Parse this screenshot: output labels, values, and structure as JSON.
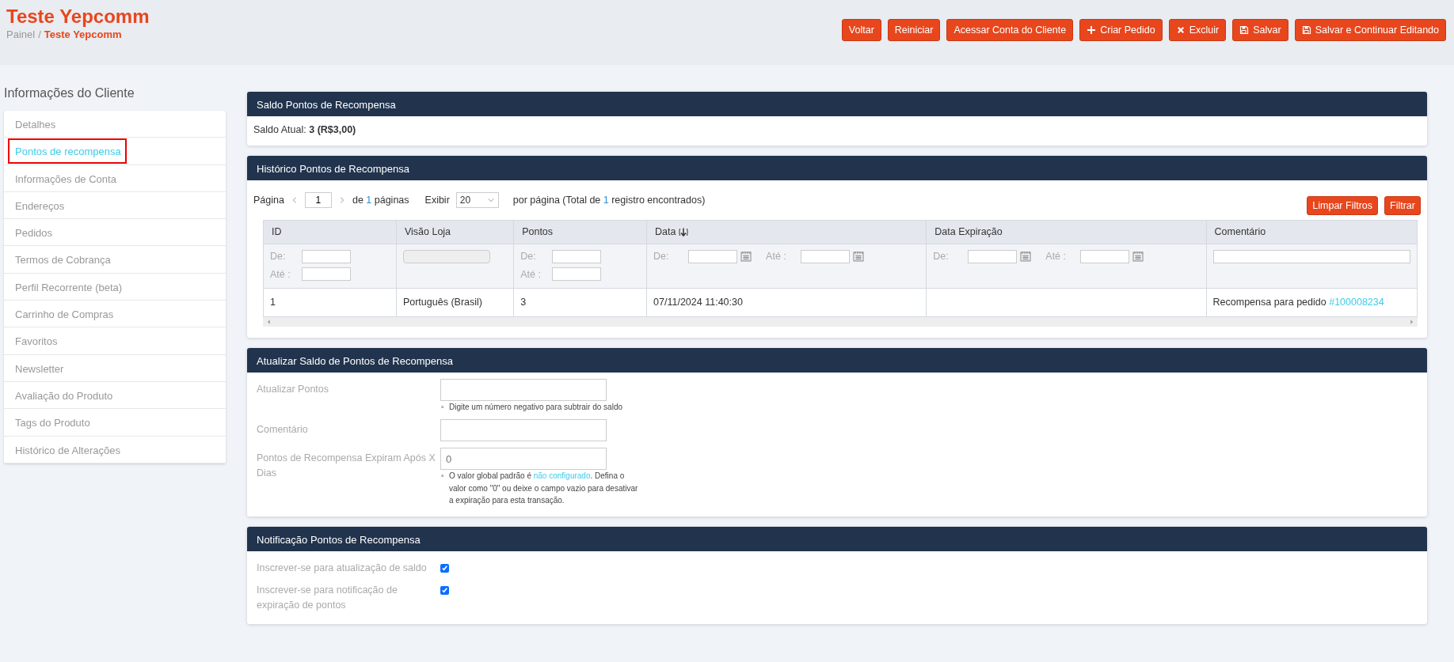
{
  "header": {
    "title": "Teste Yepcomm",
    "breadcrumb": [
      {
        "label": "Painel",
        "current": false
      },
      {
        "label": "Teste Yepcomm",
        "current": true
      }
    ],
    "separator": "/",
    "buttons": [
      {
        "label": "Voltar",
        "kind": "plain"
      },
      {
        "label": "Reiniciar",
        "kind": "plain"
      },
      {
        "label": "Acessar Conta do Cliente",
        "kind": "plain"
      },
      {
        "label": "Criar Pedido",
        "kind": "add"
      },
      {
        "label": "Excluir",
        "kind": "delete"
      },
      {
        "label": "Salvar",
        "kind": "save"
      },
      {
        "label": "Salvar e Continuar Editando",
        "kind": "save"
      }
    ]
  },
  "sidebar": {
    "title": "Informações do Cliente",
    "items": [
      {
        "label": "Detalhes",
        "selected": false
      },
      {
        "label": "Pontos de recompensa",
        "selected": true
      },
      {
        "label": "Informações de Conta",
        "selected": false
      },
      {
        "label": "Endereços",
        "selected": false
      },
      {
        "label": "Pedidos",
        "selected": false
      },
      {
        "label": "Termos de Cobrança",
        "selected": false
      },
      {
        "label": "Perfil Recorrente (beta)",
        "selected": false
      },
      {
        "label": "Carrinho de Compras",
        "selected": false
      },
      {
        "label": "Favoritos",
        "selected": false
      },
      {
        "label": "Newsletter",
        "selected": false
      },
      {
        "label": "Avaliação do Produto",
        "selected": false
      },
      {
        "label": "Tags do Produto",
        "selected": false
      },
      {
        "label": "Histórico de Alterações",
        "selected": false
      }
    ]
  },
  "balance": {
    "title": "Saldo Pontos de Recompensa",
    "label": "Saldo Atual:",
    "value": "3 (R$3,00)"
  },
  "history": {
    "title": "Histórico Pontos de Recompensa",
    "pager": {
      "page_label": "Página",
      "page": "1",
      "of_text": "de",
      "total_pages": "1",
      "pages_word": "páginas",
      "show_label": "Exibir",
      "per_page": "20",
      "per_page_text": "por página (Total de",
      "total": "1",
      "total_text": "registro encontrados)"
    },
    "buttons": [
      "Limpar Filtros",
      "Filtrar"
    ],
    "table": {
      "columns": [
        {
          "label": "ID",
          "sorted": false,
          "filter": {
            "kind": "range",
            "from": "De:",
            "to": "Até :"
          }
        },
        {
          "label": "Visão Loja",
          "sorted": false,
          "filter": {
            "kind": "select"
          }
        },
        {
          "label": "Pontos",
          "sorted": false,
          "filter": {
            "kind": "range",
            "from": "De:",
            "to": "Até :"
          }
        },
        {
          "label": "Data",
          "sorted": true,
          "filter": {
            "kind": "date_range",
            "from": "De:",
            "to": "Até :"
          }
        },
        {
          "label": "Data Expiração",
          "sorted": false,
          "filter": {
            "kind": "date_range",
            "from": "De:",
            "to": "Até :"
          }
        },
        {
          "label": "Comentário",
          "sorted": false,
          "filter": {
            "kind": "text"
          }
        }
      ],
      "rows": [
        {
          "cells": [
            {
              "text": "1"
            },
            {
              "text": "Português (Brasil)"
            },
            {
              "text": "3"
            },
            {
              "text": "07/11/2024 11:40:30"
            },
            {
              "text": ""
            },
            {
              "text": "Recompensa para pedido",
              "link": "#100008234"
            }
          ]
        }
      ]
    }
  },
  "update": {
    "title": "Atualizar Saldo de Pontos de Recompensa",
    "fields": [
      {
        "label": "Atualizar Pontos",
        "hint": [
          {
            "kind": "text",
            "text": "Digite um número negativo para subtrair do saldo"
          }
        ]
      },
      {
        "label": "Comentário"
      },
      {
        "label": "Pontos de Recompensa Expiram Após X Dias",
        "placeholder": "0",
        "hint": [
          {
            "kind": "text",
            "text": "O valor global padrão é"
          },
          {
            "kind": "link",
            "text": "não configurado"
          },
          {
            "kind": "text",
            "text": ". Defina o valor como \"0\" ou deixe o campo vazio para desativar a expiração para esta transação."
          }
        ]
      }
    ]
  },
  "notification": {
    "title": "Notificação Pontos de Recompensa",
    "options": [
      {
        "label": "Inscrever-se para atualização de saldo",
        "checked": true
      },
      {
        "label": "Inscrever-se para notificação de expiração de pontos",
        "checked": true
      }
    ]
  }
}
